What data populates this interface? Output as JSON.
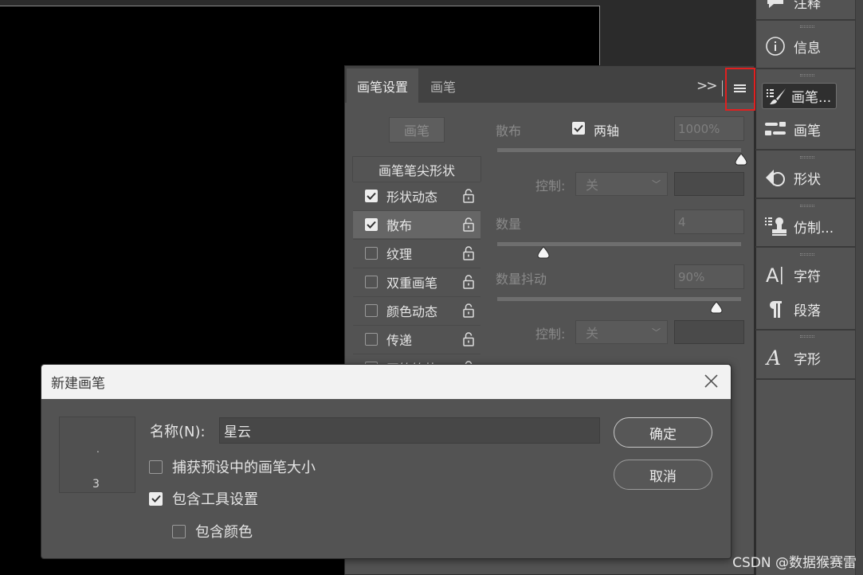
{
  "right_panel": {
    "items": [
      {
        "label": "注释",
        "icon": "comment-icon"
      },
      {
        "label": "信息",
        "icon": "info-icon"
      },
      {
        "label": "画笔...",
        "icon": "brush-settings-icon"
      },
      {
        "label": "画笔",
        "icon": "brushes-icon"
      },
      {
        "label": "形状",
        "icon": "shapes-icon"
      },
      {
        "label": "仿制...",
        "icon": "clone-source-icon"
      },
      {
        "label": "字符",
        "icon": "character-icon"
      },
      {
        "label": "段落",
        "icon": "paragraph-icon"
      },
      {
        "label": "字形",
        "icon": "glyphs-icon"
      }
    ]
  },
  "brush_panel": {
    "tabs": [
      "画笔设置",
      "画笔"
    ],
    "expand_glyph": ">>",
    "brush_button": "画笔",
    "tip_shape_header": "画笔笔尖形状",
    "options": [
      {
        "label": "形状动态",
        "checked": true,
        "selected": false
      },
      {
        "label": "散布",
        "checked": true,
        "selected": true
      },
      {
        "label": "纹理",
        "checked": false,
        "selected": false
      },
      {
        "label": "双重画笔",
        "checked": false,
        "selected": false
      },
      {
        "label": "颜色动态",
        "checked": false,
        "selected": false
      },
      {
        "label": "传递",
        "checked": false,
        "selected": false
      },
      {
        "label": "画笔笔势",
        "checked": false,
        "selected": false
      }
    ],
    "scatter_label": "散布",
    "both_axes_label": "两轴",
    "both_axes_checked": true,
    "scatter_value": "1000%",
    "scatter_level": 1.0,
    "control_label": "控制:",
    "control_value": "关",
    "count_label": "数量",
    "count_value": "4",
    "count_level": 0.19,
    "count_jitter_label": "数量抖动",
    "count_jitter_value": "90%",
    "count_jitter_level": 0.9,
    "control2_label": "控制:",
    "control2_value": "关"
  },
  "dialog": {
    "title": "新建画笔",
    "preview_size": "3",
    "preview_dot": ".",
    "name_label": "名称(N):",
    "name_value": "星云",
    "capture_size_label": "捕获预设中的画笔大小",
    "capture_size_checked": false,
    "include_tool_label": "包含工具设置",
    "include_tool_checked": true,
    "include_color_label": "包含颜色",
    "include_color_checked": false,
    "ok_label": "确定",
    "cancel_label": "取消"
  },
  "watermark": "CSDN @数据猴赛雷",
  "colors": {
    "highlight_box": "#e02020",
    "canvas": "#000000",
    "panel": "#535353"
  }
}
